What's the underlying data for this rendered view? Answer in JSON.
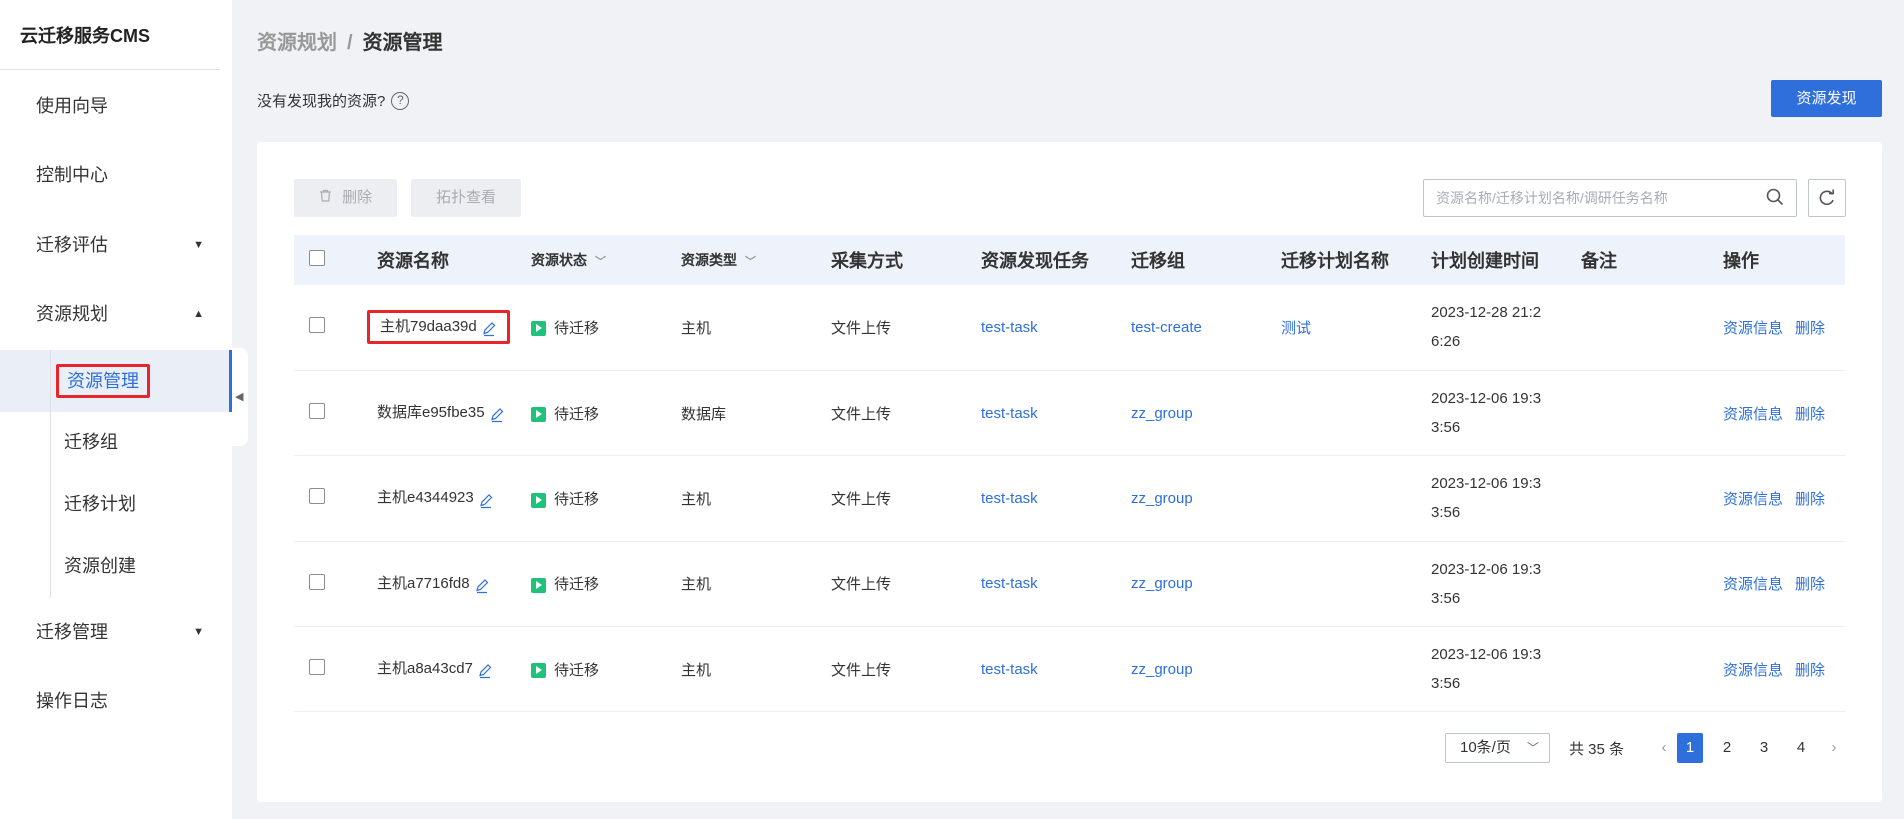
{
  "sidebar": {
    "brand": "云迁移服务CMS",
    "items": [
      {
        "label": "使用向导"
      },
      {
        "label": "控制中心"
      },
      {
        "label": "迁移评估"
      },
      {
        "label": "资源规划"
      },
      {
        "label": "迁移管理"
      },
      {
        "label": "操作日志"
      }
    ],
    "sub_items": [
      {
        "label": "资源管理"
      },
      {
        "label": "迁移组"
      },
      {
        "label": "迁移计划"
      },
      {
        "label": "资源创建"
      }
    ]
  },
  "header": {
    "crumb_parent": "资源规划",
    "crumb_sep": "/",
    "crumb_current": "资源管理",
    "hint": "没有发现我的资源?",
    "help": "?",
    "discover_button": "资源发现"
  },
  "toolbar": {
    "delete_label": "删除",
    "topology_label": "拓扑查看",
    "search_placeholder": "资源名称/迁移计划名称/调研任务名称"
  },
  "table": {
    "headers": [
      "资源名称",
      "资源状态",
      "资源类型",
      "采集方式",
      "资源发现任务",
      "迁移组",
      "迁移计划名称",
      "计划创建时间",
      "备注",
      "操作"
    ],
    "rows": [
      {
        "name": "主机79daa39d",
        "status": "待迁移",
        "type": "主机",
        "method": "文件上传",
        "task": "test-task",
        "group": "test-create",
        "plan": "测试",
        "time1": "2023-12-28 21:2",
        "time2": "6:26",
        "note": "",
        "op_info": "资源信息",
        "op_delete": "删除"
      },
      {
        "name": "数据库e95fbe35",
        "status": "待迁移",
        "type": "数据库",
        "method": "文件上传",
        "task": "test-task",
        "group": "zz_group",
        "plan": "",
        "time1": "2023-12-06 19:3",
        "time2": "3:56",
        "note": "",
        "op_info": "资源信息",
        "op_delete": "删除"
      },
      {
        "name": "主机e4344923",
        "status": "待迁移",
        "type": "主机",
        "method": "文件上传",
        "task": "test-task",
        "group": "zz_group",
        "plan": "",
        "time1": "2023-12-06 19:3",
        "time2": "3:56",
        "note": "",
        "op_info": "资源信息",
        "op_delete": "删除"
      },
      {
        "name": "主机a7716fd8",
        "status": "待迁移",
        "type": "主机",
        "method": "文件上传",
        "task": "test-task",
        "group": "zz_group",
        "plan": "",
        "time1": "2023-12-06 19:3",
        "time2": "3:56",
        "note": "",
        "op_info": "资源信息",
        "op_delete": "删除"
      },
      {
        "name": "主机a8a43cd7",
        "status": "待迁移",
        "type": "主机",
        "method": "文件上传",
        "task": "test-task",
        "group": "zz_group",
        "plan": "",
        "time1": "2023-12-06 19:3",
        "time2": "3:56",
        "note": "",
        "op_info": "资源信息",
        "op_delete": "删除"
      }
    ]
  },
  "pagination": {
    "page_size": "10条/页",
    "total": "共 35 条",
    "pages": [
      "1",
      "2",
      "3",
      "4"
    ],
    "current": "1"
  },
  "colors": {
    "accent": "#2e6fdb",
    "status_green": "#1ec27a",
    "highlight_red": "#e8262a"
  }
}
